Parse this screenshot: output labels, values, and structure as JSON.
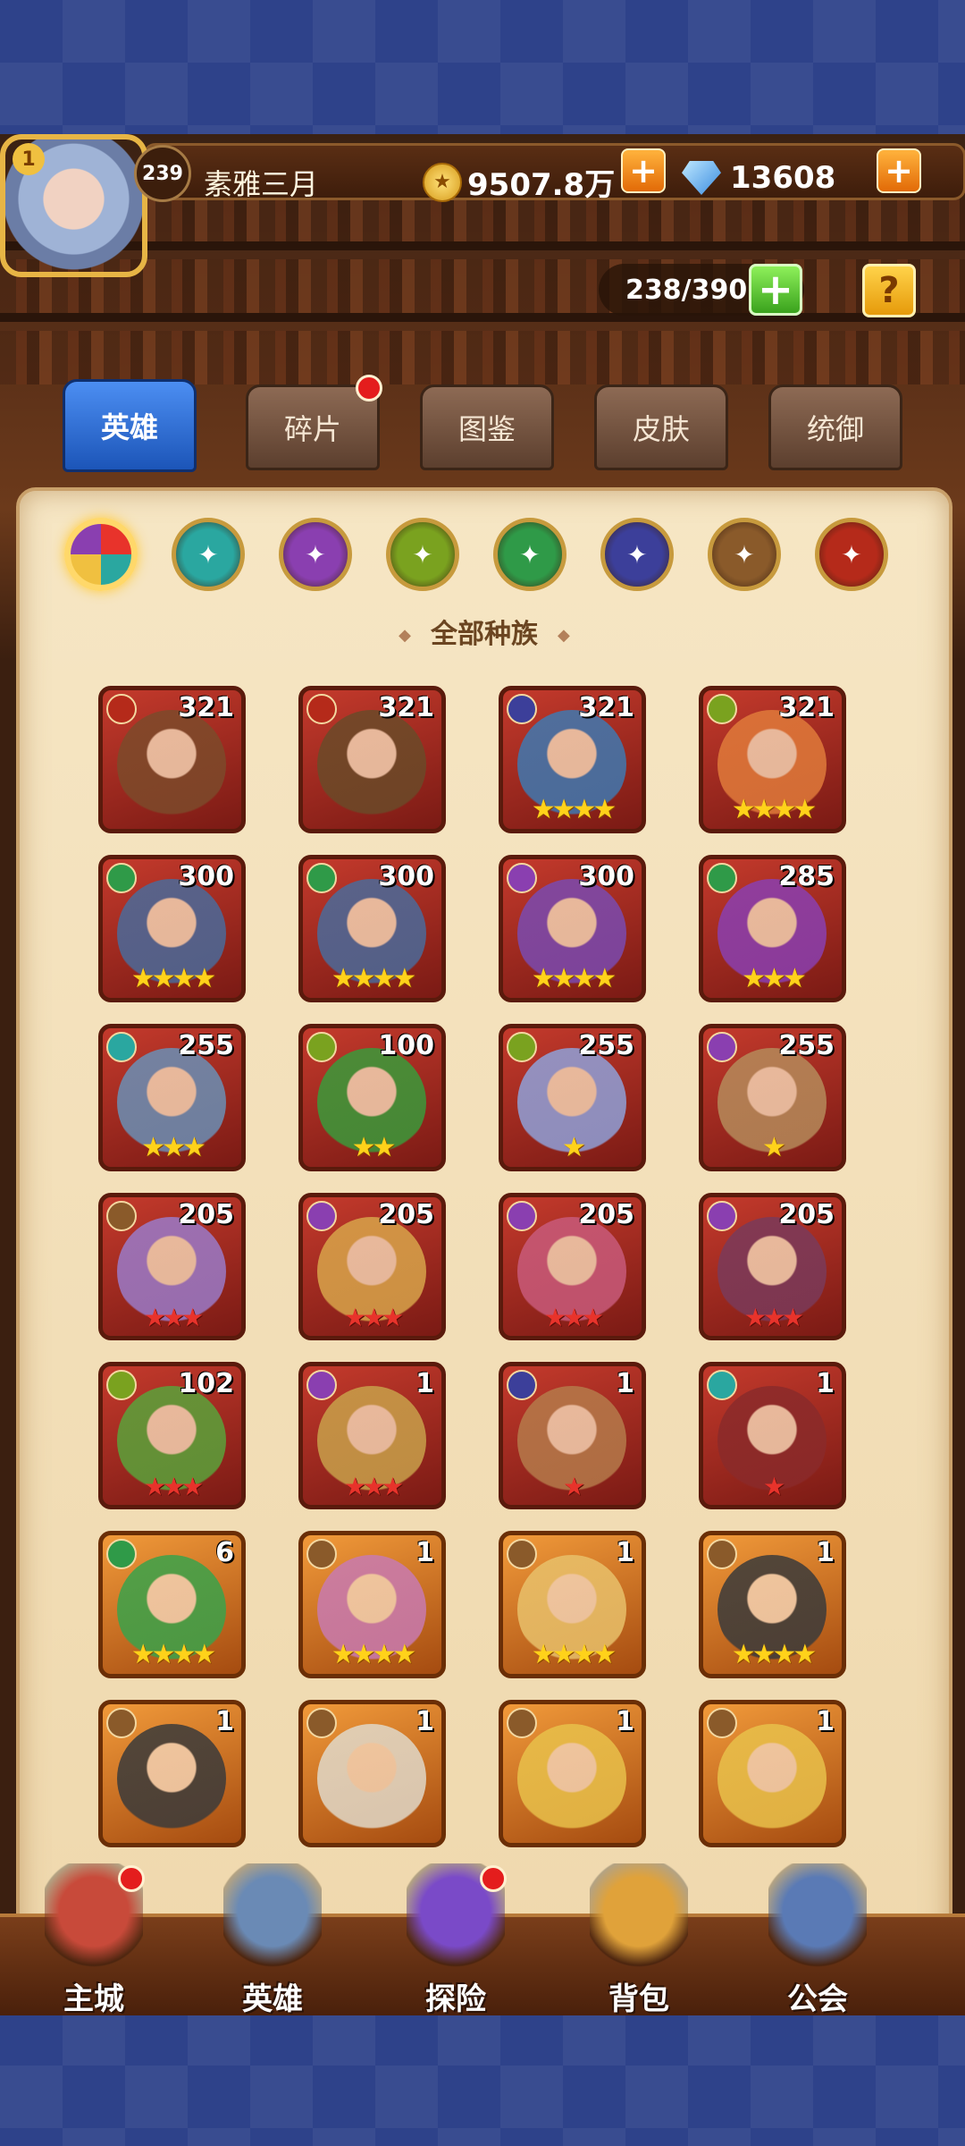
{
  "player": {
    "rank": "1",
    "level": "239",
    "name": "素雅三月"
  },
  "currency": {
    "gold": "9507.8万",
    "gems": "13608"
  },
  "hero_count": "238/390",
  "help_label": "?",
  "tabs": [
    {
      "label": "英雄",
      "active": true
    },
    {
      "label": "碎片",
      "badge": true
    },
    {
      "label": "图鉴"
    },
    {
      "label": "皮肤"
    },
    {
      "label": "统御"
    }
  ],
  "race_filters": [
    {
      "icon": "all-races-icon",
      "color": "#e85a3a",
      "active": true
    },
    {
      "icon": "ice-race-icon",
      "color": "#2aa7a0"
    },
    {
      "icon": "mystic-race-icon",
      "color": "#8a3fb0"
    },
    {
      "icon": "eye-race-icon",
      "color": "#7aa21f"
    },
    {
      "icon": "leaf-race-icon",
      "color": "#2f9a48"
    },
    {
      "icon": "demon-race-icon",
      "color": "#3c3f9a"
    },
    {
      "icon": "light-race-icon",
      "color": "#8a5a2a"
    },
    {
      "icon": "fire-race-icon",
      "color": "#b52a1a"
    }
  ],
  "race_title": "全部种族",
  "heroes": [
    {
      "level": "321",
      "stars": "",
      "color": "#7c4a2a",
      "race": "#b52a1a",
      "frame": "red"
    },
    {
      "level": "321",
      "stars": "",
      "color": "#6a4a28",
      "race": "#b52a1a",
      "frame": "red"
    },
    {
      "level": "321",
      "stars": "★★★★",
      "color": "#3f78b0",
      "race": "#3c3f9a",
      "frame": "red"
    },
    {
      "level": "321",
      "stars": "★★★★",
      "color": "#e07a3a",
      "race": "#7aa21f",
      "frame": "red"
    },
    {
      "level": "300",
      "stars": "★★★★",
      "color": "#4a6a9a",
      "race": "#2f9a48",
      "frame": "red"
    },
    {
      "level": "300",
      "stars": "★★★★",
      "color": "#4a6a9a",
      "race": "#2f9a48",
      "frame": "red"
    },
    {
      "level": "300",
      "stars": "★★★★",
      "color": "#7a4ab0",
      "race": "#8a3fb0",
      "frame": "red"
    },
    {
      "level": "285",
      "stars": "★★★",
      "color": "#8a3fb0",
      "race": "#2f9a48",
      "frame": "red"
    },
    {
      "level": "255",
      "stars": "★★★",
      "color": "#6a8fb5",
      "race": "#2aa7a0",
      "frame": "red"
    },
    {
      "level": "100",
      "stars": "★★",
      "color": "#3a9a3a",
      "race": "#7aa21f",
      "frame": "red"
    },
    {
      "level": "255",
      "stars": "★",
      "color": "#8fa0d8",
      "race": "#7aa21f",
      "frame": "red"
    },
    {
      "level": "255",
      "stars": "★",
      "color": "#b58a5a",
      "race": "#8a3fb0",
      "frame": "red"
    },
    {
      "level": "205",
      "stars": "★★★",
      "starColor": "red",
      "color": "#9a7ac8",
      "race": "#8a5a2a",
      "frame": "red"
    },
    {
      "level": "205",
      "stars": "★★★",
      "starColor": "red",
      "color": "#d8a44a",
      "race": "#8a3fb0",
      "frame": "red"
    },
    {
      "level": "205",
      "stars": "★★★",
      "starColor": "red",
      "color": "#c85a7a",
      "race": "#8a3fb0",
      "frame": "red"
    },
    {
      "level": "205",
      "stars": "★★★",
      "starColor": "red",
      "color": "#7a3a5a",
      "race": "#8a3fb0",
      "frame": "red"
    },
    {
      "level": "102",
      "stars": "★★★",
      "starColor": "red",
      "color": "#5aa23a",
      "race": "#7aa21f",
      "frame": "red"
    },
    {
      "level": "1",
      "stars": "★★★",
      "starColor": "red",
      "color": "#c8a04a",
      "race": "#8a3fb0",
      "frame": "red"
    },
    {
      "level": "1",
      "stars": "★",
      "starColor": "red",
      "color": "#b57a4a",
      "race": "#3c3f9a",
      "frame": "red"
    },
    {
      "level": "1",
      "stars": "★",
      "starColor": "red",
      "color": "#8a2a2a",
      "race": "#2aa7a0",
      "frame": "red"
    },
    {
      "level": "6",
      "stars": "★★★★",
      "color": "#3aa24a",
      "race": "#2f9a48",
      "frame": "orange"
    },
    {
      "level": "1",
      "stars": "★★★★",
      "color": "#c87ab0",
      "race": "#8a5a2a",
      "frame": "orange"
    },
    {
      "level": "1",
      "stars": "★★★★",
      "color": "#e8c06a",
      "race": "#8a5a2a",
      "frame": "orange"
    },
    {
      "level": "1",
      "stars": "★★★★",
      "color": "#3a3a3a",
      "race": "#8a5a2a",
      "frame": "orange"
    },
    {
      "level": "1",
      "stars": "",
      "color": "#3a3a3a",
      "race": "#8a5a2a",
      "frame": "orange"
    },
    {
      "level": "1",
      "stars": "",
      "color": "#e0d8c8",
      "race": "#8a5a2a",
      "frame": "orange"
    },
    {
      "level": "1",
      "stars": "",
      "color": "#e8c04a",
      "race": "#8a5a2a",
      "frame": "orange"
    },
    {
      "level": "1",
      "stars": "",
      "color": "#e8c04a",
      "race": "#8a5a2a",
      "frame": "orange"
    }
  ],
  "nav": [
    {
      "label": "主城",
      "icon": "castle-icon",
      "color": "#c84a3a",
      "badge": true
    },
    {
      "label": "英雄",
      "icon": "hero-icon",
      "color": "#6a8ab5"
    },
    {
      "label": "探险",
      "icon": "portal-icon",
      "color": "#7a4ac8",
      "badge": true
    },
    {
      "label": "背包",
      "icon": "backpack-icon",
      "color": "#e0a23a"
    },
    {
      "label": "公会",
      "icon": "guild-icon",
      "color": "#5a7ab5"
    }
  ]
}
